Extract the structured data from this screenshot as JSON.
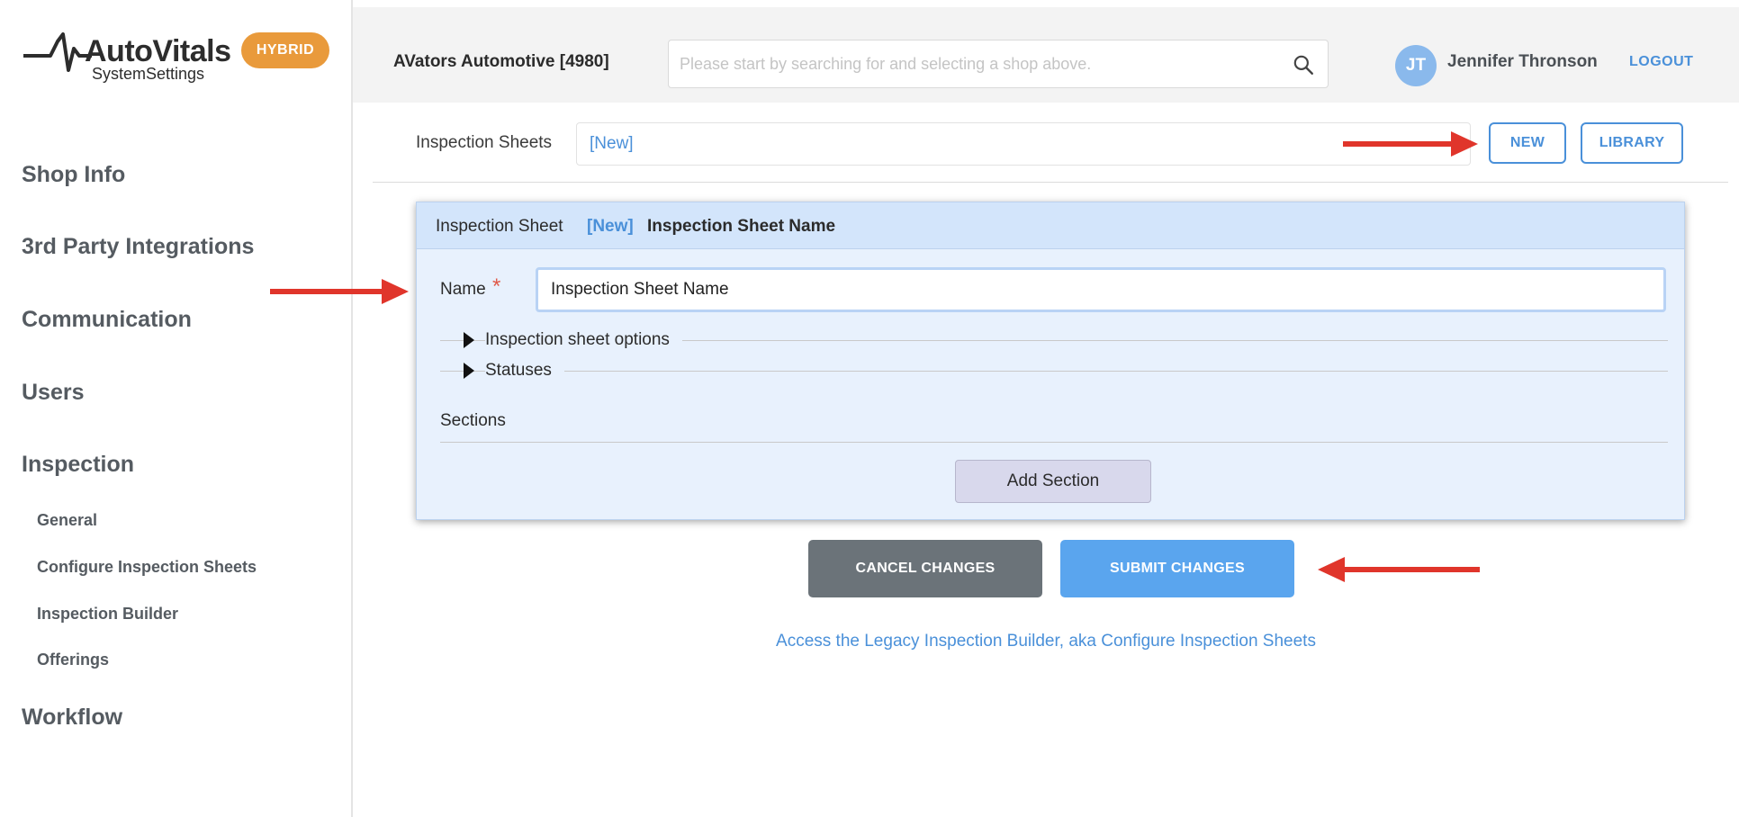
{
  "brand": {
    "title": "AutoVitals",
    "subtitle": "SystemSettings",
    "badge": "HYBRID",
    "badge_color": "#e99a3b"
  },
  "sidebar": {
    "items": [
      {
        "label": "Shop Info",
        "level": "main"
      },
      {
        "label": "3rd Party Integrations",
        "level": "main"
      },
      {
        "label": "Communication",
        "level": "main"
      },
      {
        "label": "Users",
        "level": "main"
      },
      {
        "label": "Inspection",
        "level": "main"
      },
      {
        "label": "General",
        "level": "sub"
      },
      {
        "label": "Configure Inspection Sheets",
        "level": "sub"
      },
      {
        "label": "Inspection Builder",
        "level": "sub"
      },
      {
        "label": "Offerings",
        "level": "sub"
      },
      {
        "label": "Workflow",
        "level": "main"
      }
    ]
  },
  "header": {
    "shop_name": "AVators Automotive [4980]",
    "search_placeholder": "Please start by searching for and selecting a shop above.",
    "search_value": "",
    "user_initials": "JT",
    "user_name": "Jennifer Thronson",
    "logout_label": "LOGOUT",
    "accent_color": "#4a90d9"
  },
  "sheet_selector": {
    "label": "Inspection Sheets",
    "selected": "[New]",
    "new_label": "NEW",
    "library_label": "LIBRARY"
  },
  "panel": {
    "header_label": "Inspection Sheet",
    "header_tag": "[New]",
    "header_name": "Inspection Sheet Name",
    "name_label": "Name",
    "required_mark": "*",
    "name_value": "Inspection Sheet Name",
    "options_label": "Inspection sheet options",
    "statuses_label": "Statuses",
    "sections_label": "Sections",
    "add_section_label": "Add Section"
  },
  "actions": {
    "cancel_label": "CANCEL CHANGES",
    "submit_label": "SUBMIT CHANGES"
  },
  "footer": {
    "legacy_link": "Access the Legacy Inspection Builder, aka Configure Inspection Sheets"
  },
  "annotations": {
    "arrow_color": "#e0352b"
  }
}
